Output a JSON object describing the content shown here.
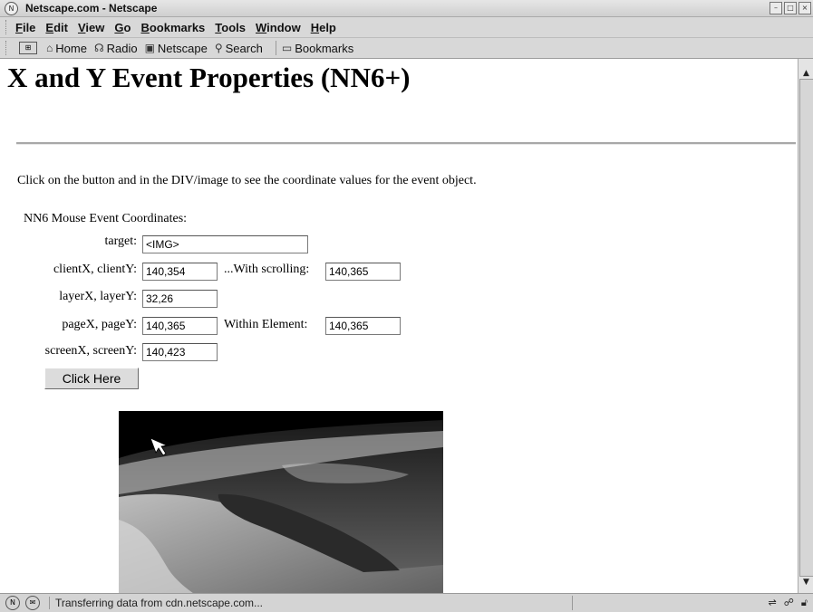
{
  "window": {
    "title": "Netscape.com - Netscape"
  },
  "menubar": {
    "items": [
      "File",
      "Edit",
      "View",
      "Go",
      "Bookmarks",
      "Tools",
      "Window",
      "Help"
    ]
  },
  "toolbar": {
    "home": "Home",
    "radio": "Radio",
    "netscape": "Netscape",
    "search": "Search",
    "bookmarks": "Bookmarks"
  },
  "page": {
    "title": "X and Y Event Properties (NN6+)",
    "instructions": "Click on the button and in the DIV/image to see the coordinate values for the event object.",
    "table_heading": "NN6 Mouse Event Coordinates:",
    "rows": {
      "target": {
        "label": "target:",
        "value": "<IMG>"
      },
      "client": {
        "label": "clientX, clientY:",
        "value": "140,354"
      },
      "scrolling": {
        "label": "...With scrolling:",
        "value": "140,365"
      },
      "layer": {
        "label": "layerX, layerY:",
        "value": "32,26"
      },
      "page": {
        "label": "pageX, pageY:",
        "value": "140,365"
      },
      "within": {
        "label": "Within Element:",
        "value": "140,365"
      },
      "screen": {
        "label": "screenX, screenY:",
        "value": "140,423"
      }
    },
    "button_label": "Click Here"
  },
  "statusbar": {
    "text": "Transferring data from cdn.netscape.com..."
  },
  "icons": {
    "home": "home-icon",
    "radio": "radio-icon",
    "netscape": "my-netscape-icon",
    "search": "search-icon",
    "bookmarks": "bookmarks-folder-icon"
  }
}
